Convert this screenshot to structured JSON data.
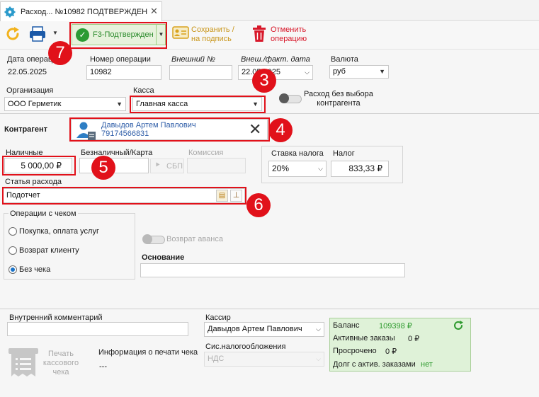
{
  "tab": {
    "title": "Расход... №10982 ПОДТВЕРЖДЕН"
  },
  "toolbar": {
    "confirm_label": "F3-Подтвержден",
    "save_label_1": "Сохранить /",
    "save_label_2": "на подпись",
    "cancel_label_1": "Отменить",
    "cancel_label_2": "операцию"
  },
  "form": {
    "date_label": "Дата операции",
    "date_value": "22.05.2025",
    "number_label": "Номер операции",
    "number_value": "10982",
    "external_label": "Внешний №",
    "external_value": "",
    "ext_date_label": "Внеш./факт. дата",
    "ext_date_value": "22.05.2025",
    "currency_label": "Валюта",
    "currency_value": "руб",
    "org_label": "Организация",
    "org_value": "ООО Герметик",
    "kassa_label": "Касса",
    "kassa_value": "Главная касса",
    "no_contragent_label_1": "Расход без выбора",
    "no_contragent_label_2": "контрагента",
    "contragent_label": "Контрагент",
    "contragent_name": "Давыдов Артем Павлович",
    "contragent_phone": "79174566831",
    "cash_label": "Наличные",
    "cash_value": "5 000,00 ₽",
    "cashless_label": "Безналичный/Карта",
    "cashless_value": "",
    "sbp_label": "СБП",
    "commission_label": "Комиссия",
    "tax_rate_label": "Ставка налога",
    "tax_rate_value": "20%",
    "tax_label": "Налог",
    "tax_value": "833,33 ₽",
    "expense_item_label": "Статья расхода",
    "expense_item_value": "Подотчет"
  },
  "receipt_ops": {
    "title": "Операции с чеком",
    "options": [
      "Покупка, оплата услуг",
      "Возврат клиенту",
      "Без чека"
    ],
    "selected": "Без чека"
  },
  "advance_return_label": "Возврат аванса",
  "basis_label": "Основание",
  "basis_value": "",
  "bottom": {
    "comment_label": "Внутренний комментарий",
    "comment_value": "",
    "print_label_1": "Печать",
    "print_label_2": "кассового",
    "print_label_3": "чека",
    "print_info_label": "Информация о печати чека",
    "print_info_value": "---",
    "cashier_label": "Кассир",
    "cashier_value": "Давыдов Артем Павлович",
    "tax_system_label": "Сис.налогообложения",
    "tax_system_value": "НДС"
  },
  "balance": {
    "balance_label": "Баланс",
    "balance_value": "109398 ₽",
    "active_orders_label": "Активные заказы",
    "active_orders_value": "0 ₽",
    "overdue_label": "Просрочено",
    "overdue_value": "0 ₽",
    "debt_label": "Долг с актив. заказами",
    "debt_value": "нет"
  },
  "annotations": [
    "3",
    "4",
    "5",
    "6",
    "7"
  ],
  "colors": {
    "accent": "#1a73c8",
    "annotation": "#e1111a",
    "positive": "#2e9a2e",
    "danger": "#d8182a"
  }
}
